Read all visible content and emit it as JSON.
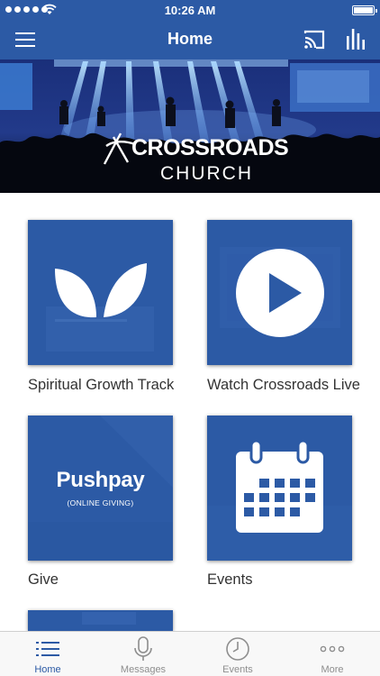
{
  "status_bar": {
    "time": "10:26 AM"
  },
  "nav": {
    "title": "Home"
  },
  "hero": {
    "logo_line1": "CROSSROADS",
    "logo_line2": "CHURCH"
  },
  "tiles": [
    {
      "label": "Spiritual Growth Track",
      "icon": "leaves-icon"
    },
    {
      "label": "Watch Crossroads Live",
      "icon": "play-icon"
    },
    {
      "label": "Give",
      "icon": "pushpay-logo",
      "brand": "Pushpay",
      "brand_sub": "(ONLINE GIVING)"
    },
    {
      "label": "Events",
      "icon": "calendar-icon"
    }
  ],
  "tab_bar": {
    "items": [
      {
        "label": "Home",
        "icon": "list-icon",
        "active": true
      },
      {
        "label": "Messages",
        "icon": "microphone-icon",
        "active": false
      },
      {
        "label": "Events",
        "icon": "clock-icon",
        "active": false
      },
      {
        "label": "More",
        "icon": "more-icon",
        "active": false
      }
    ]
  },
  "colors": {
    "brand_blue": "#2c5aa5",
    "tab_inactive": "#8e8e8e",
    "tab_bar_bg": "#f8f8f8"
  }
}
